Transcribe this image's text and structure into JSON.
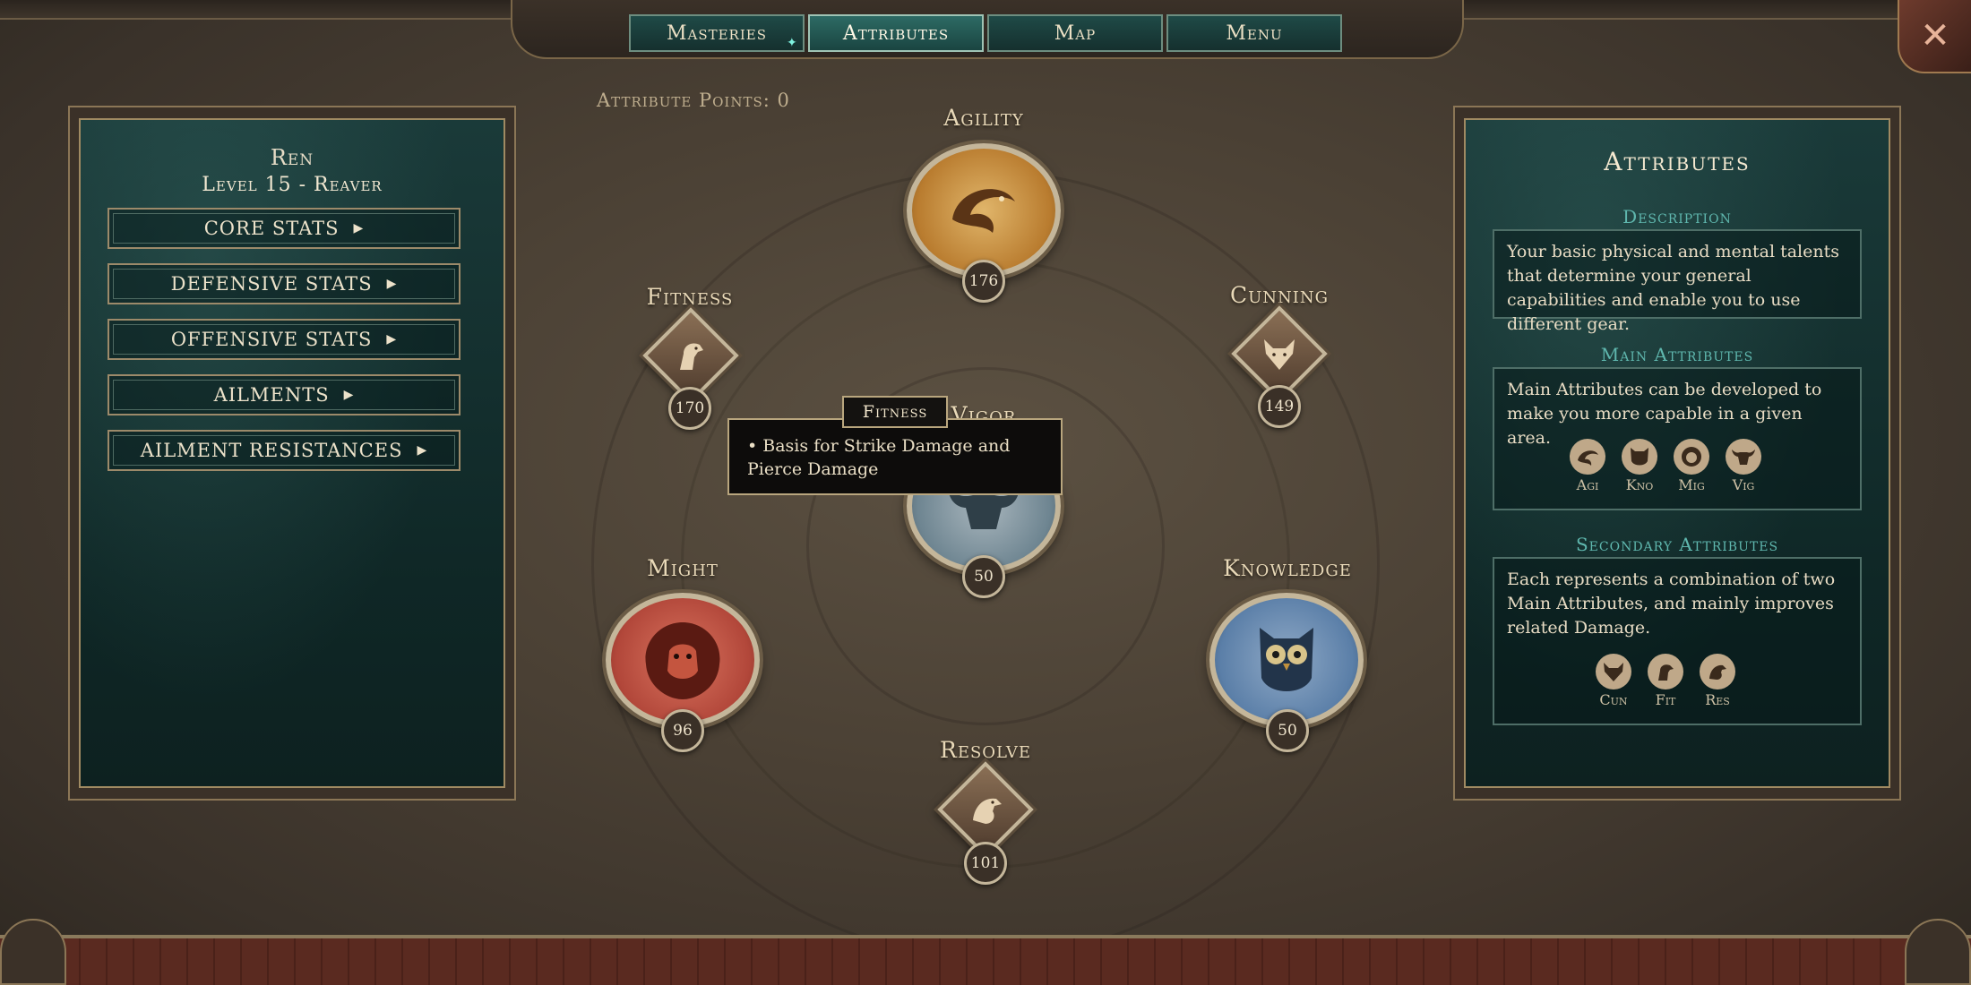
{
  "tabs": [
    {
      "label": "Masteries",
      "active": false
    },
    {
      "label": "Attributes",
      "active": true
    },
    {
      "label": "Map",
      "active": false
    },
    {
      "label": "Menu",
      "active": false
    }
  ],
  "close_icon": "close-icon",
  "character": {
    "name": "Ren",
    "level_class": "Level 15 - Reaver"
  },
  "stat_buttons": [
    {
      "label": "CORE STATS"
    },
    {
      "label": "DEFENSIVE STATS"
    },
    {
      "label": "OFFENSIVE STATS"
    },
    {
      "label": "AILMENTS"
    },
    {
      "label": "AILMENT RESISTANCES"
    }
  ],
  "attribute_points": {
    "label": "Attribute Points:",
    "value": "0"
  },
  "attributes": {
    "agility": {
      "label": "Agility",
      "value": "176",
      "icon": "dolphin-icon"
    },
    "fitness": {
      "label": "Fitness",
      "value": "170",
      "icon": "horse-icon"
    },
    "cunning": {
      "label": "Cunning",
      "value": "149",
      "icon": "fox-icon"
    },
    "vigor": {
      "label": "Vigor",
      "value": "50",
      "icon": "bull-icon"
    },
    "might": {
      "label": "Might",
      "value": "96",
      "icon": "lion-icon"
    },
    "knowledge": {
      "label": "Knowledge",
      "value": "50",
      "icon": "owl-icon"
    },
    "resolve": {
      "label": "Resolve",
      "value": "101",
      "icon": "eagle-icon"
    }
  },
  "tooltip": {
    "title": "Fitness",
    "body": "• Basis for Strike Damage and Pierce Damage"
  },
  "info_panel": {
    "title": "Attributes",
    "description": {
      "heading": "Description",
      "text": "Your basic physical and mental talents that determine your general capabilities and enable you to use different gear."
    },
    "main": {
      "heading": "Main Attributes",
      "text": "Main Attributes can be developed to make you more capable in a given area.",
      "icons": [
        {
          "abbr": "Agi",
          "icon": "dolphin-icon"
        },
        {
          "abbr": "Kno",
          "icon": "owl-icon"
        },
        {
          "abbr": "Mig",
          "icon": "lion-icon"
        },
        {
          "abbr": "Vig",
          "icon": "bull-icon"
        }
      ]
    },
    "secondary": {
      "heading": "Secondary Attributes",
      "text": "Each represents a combination of two Main Attributes, and mainly improves related Damage.",
      "icons": [
        {
          "abbr": "Cun",
          "icon": "fox-icon"
        },
        {
          "abbr": "Fit",
          "icon": "horse-icon"
        },
        {
          "abbr": "Res",
          "icon": "eagle-icon"
        }
      ]
    }
  },
  "colors": {
    "teal_accent": "#5fb7ae",
    "panel_bg": "#0f2726",
    "gold_border": "#c4b69a",
    "might_red": "#b2473a",
    "knowledge_blue": "#5b7fa8",
    "agility_orange": "#c98a3a"
  }
}
